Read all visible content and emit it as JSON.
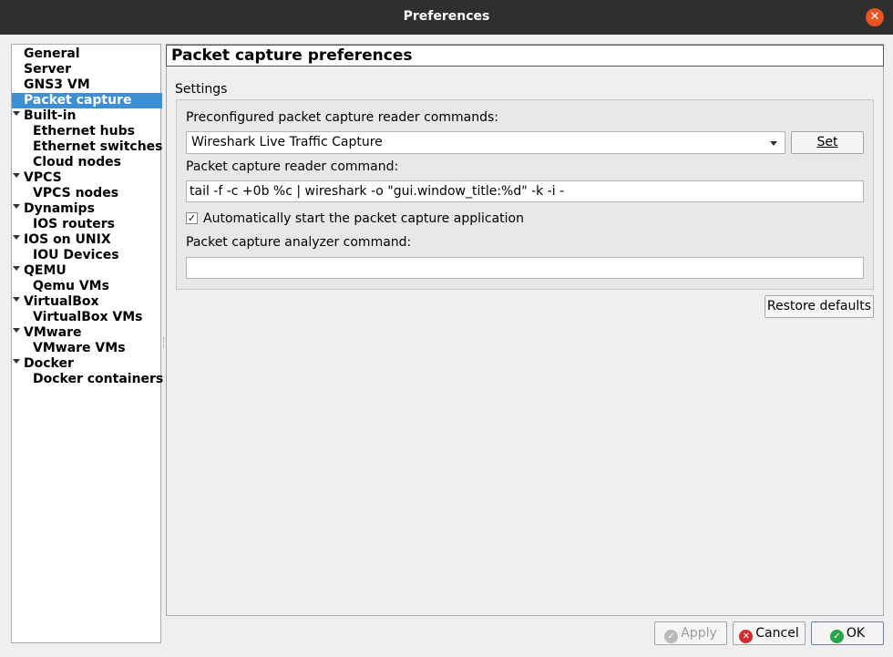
{
  "window": {
    "title": "Preferences"
  },
  "sidebar": {
    "items": [
      {
        "label": "General",
        "level": 0,
        "expanded": null,
        "selected": false
      },
      {
        "label": "Server",
        "level": 0,
        "expanded": null,
        "selected": false
      },
      {
        "label": "GNS3 VM",
        "level": 0,
        "expanded": null,
        "selected": false
      },
      {
        "label": "Packet capture",
        "level": 0,
        "expanded": null,
        "selected": true
      },
      {
        "label": "Built-in",
        "level": 0,
        "expanded": true,
        "selected": false
      },
      {
        "label": "Ethernet hubs",
        "level": 1,
        "expanded": null,
        "selected": false
      },
      {
        "label": "Ethernet switches",
        "level": 1,
        "expanded": null,
        "selected": false
      },
      {
        "label": "Cloud nodes",
        "level": 1,
        "expanded": null,
        "selected": false
      },
      {
        "label": "VPCS",
        "level": 0,
        "expanded": true,
        "selected": false
      },
      {
        "label": "VPCS nodes",
        "level": 1,
        "expanded": null,
        "selected": false
      },
      {
        "label": "Dynamips",
        "level": 0,
        "expanded": true,
        "selected": false
      },
      {
        "label": "IOS routers",
        "level": 1,
        "expanded": null,
        "selected": false
      },
      {
        "label": "IOS on UNIX",
        "level": 0,
        "expanded": true,
        "selected": false
      },
      {
        "label": "IOU Devices",
        "level": 1,
        "expanded": null,
        "selected": false
      },
      {
        "label": "QEMU",
        "level": 0,
        "expanded": true,
        "selected": false
      },
      {
        "label": "Qemu VMs",
        "level": 1,
        "expanded": null,
        "selected": false
      },
      {
        "label": "VirtualBox",
        "level": 0,
        "expanded": true,
        "selected": false
      },
      {
        "label": "VirtualBox VMs",
        "level": 1,
        "expanded": null,
        "selected": false
      },
      {
        "label": "VMware",
        "level": 0,
        "expanded": true,
        "selected": false
      },
      {
        "label": "VMware VMs",
        "level": 1,
        "expanded": null,
        "selected": false
      },
      {
        "label": "Docker",
        "level": 0,
        "expanded": true,
        "selected": false
      },
      {
        "label": "Docker containers",
        "level": 1,
        "expanded": null,
        "selected": false
      }
    ]
  },
  "page": {
    "title": "Packet capture preferences",
    "group_label": "Settings",
    "preconfigured_label": "Preconfigured packet capture reader commands:",
    "preconfigured_value": "Wireshark Live Traffic Capture",
    "set_button": "Set",
    "reader_command_label": "Packet capture reader command:",
    "reader_command_value": "tail -f -c +0b %c | wireshark -o \"gui.window_title:%d\" -k -i -",
    "auto_start_label": "Automatically start the packet capture application",
    "auto_start_checked": true,
    "analyzer_command_label": "Packet capture analyzer command:",
    "analyzer_command_value": "",
    "restore_button": "Restore defaults"
  },
  "footer": {
    "apply_button": "Apply",
    "apply_enabled": false,
    "cancel_button": "Cancel",
    "ok_button": "OK"
  },
  "icons": {
    "close": "close-icon",
    "apply": "check-circle-icon",
    "cancel": "x-circle-icon",
    "ok": "check-circle-icon"
  },
  "colors": {
    "selection": "#3c8fd3",
    "titlebar": "#2f2f2f",
    "close_button": "#e95420",
    "ok_icon": "#2aa34a",
    "cancel_icon": "#d12b2b"
  }
}
